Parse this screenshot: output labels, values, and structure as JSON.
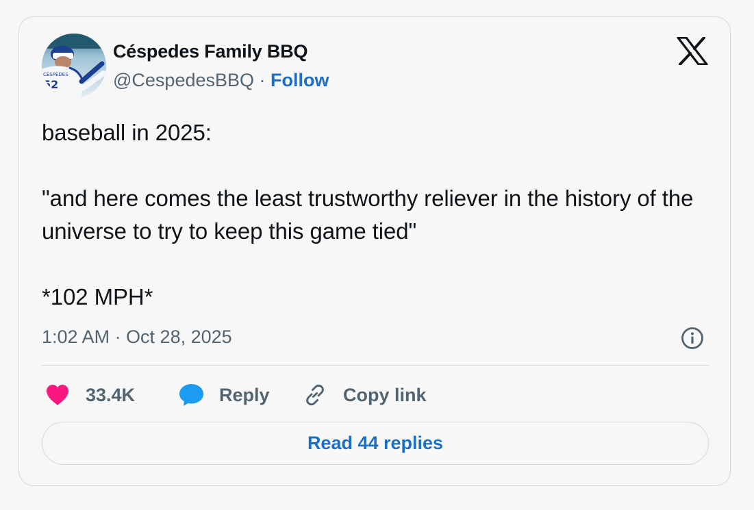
{
  "tweet": {
    "author": {
      "display_name": "Céspedes Family BBQ",
      "handle": "@CespedesBBQ",
      "separator": " · ",
      "follow_label": "Follow",
      "avatar_jersey_text": "CESPEDES",
      "avatar_jersey_number": "52"
    },
    "platform_logo_icon": "x-logo-icon",
    "text": "baseball in 2025:\n\n\"and here comes the least trustworthy reliever in the history of the universe to try to keep this game tied\"\n\n*102 MPH*",
    "timestamp": "1:02 AM · Oct 28, 2025",
    "info_icon": "info-icon",
    "actions": {
      "like": {
        "icon": "heart-icon",
        "label": "33.4K",
        "color": "#f91880"
      },
      "reply": {
        "icon": "speech-bubble-icon",
        "label": "Reply",
        "color": "#1d9bf0"
      },
      "copy_link": {
        "icon": "link-icon",
        "label": "Copy link"
      }
    },
    "read_replies_label": "Read 44 replies"
  },
  "colors": {
    "background": "#f7f7f7",
    "text": "#0f1419",
    "secondary_text": "#536471",
    "link": "#1d6fc4",
    "border": "#cfd9de"
  }
}
